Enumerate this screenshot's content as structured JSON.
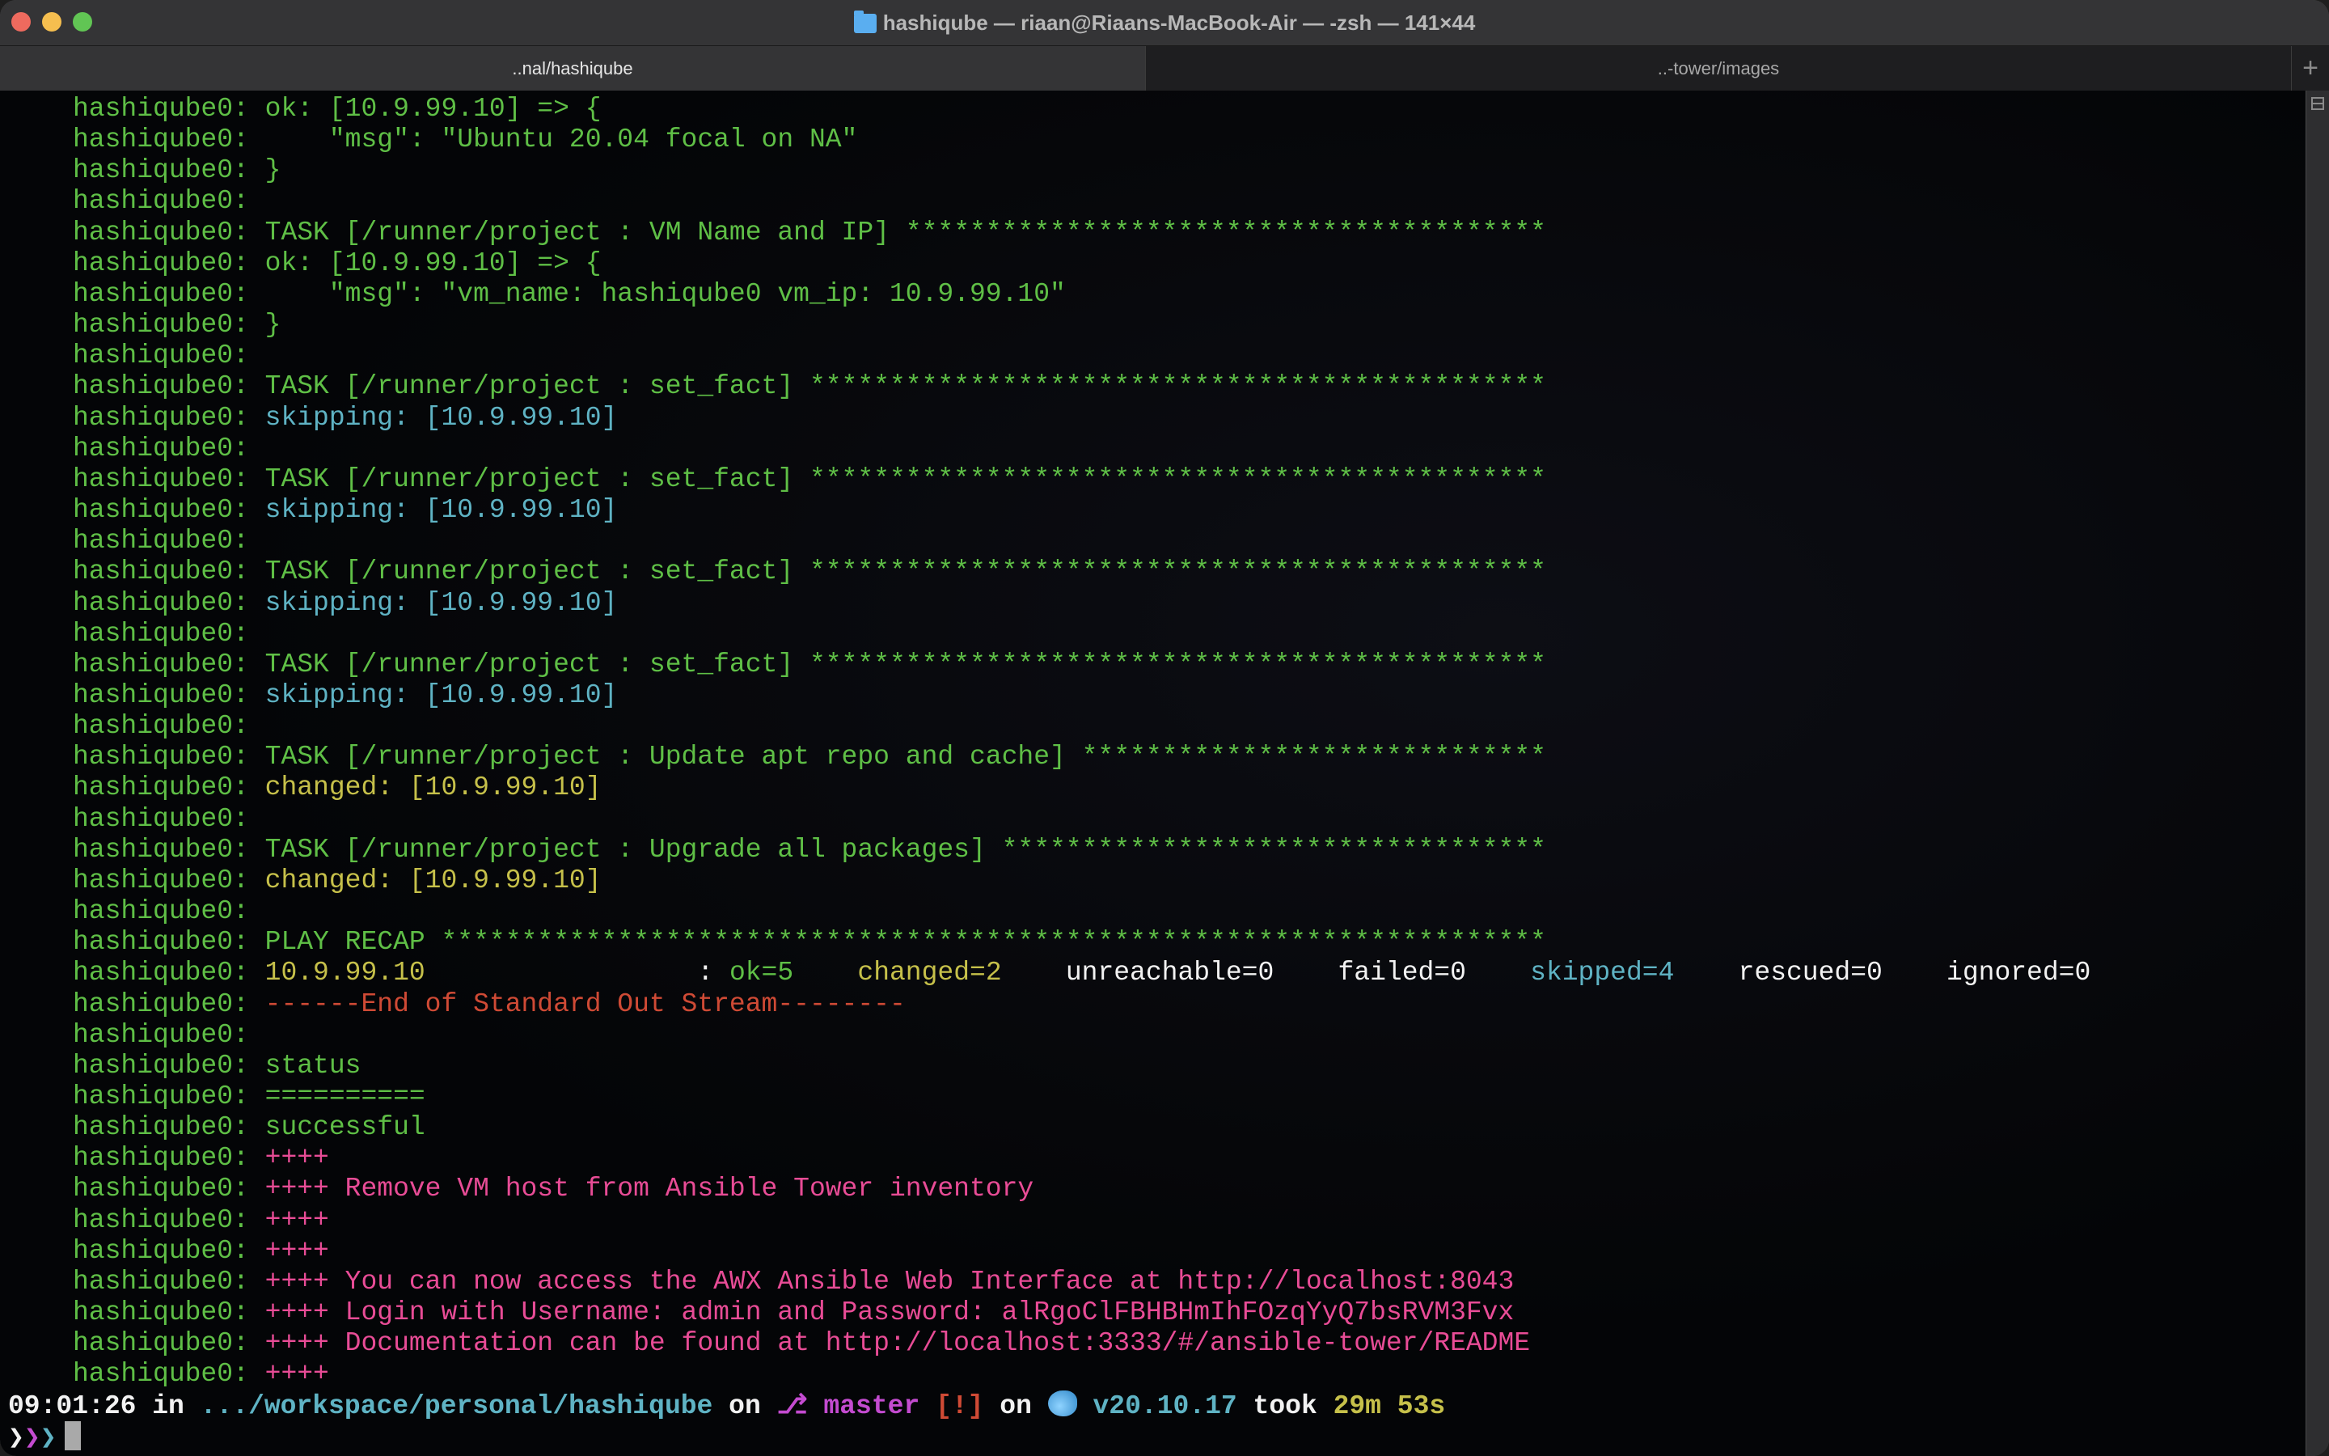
{
  "window": {
    "title": "hashiqube — riaan@Riaans-MacBook-Air — -zsh — 141×44",
    "title_icon": "folder-icon"
  },
  "tabs": [
    {
      "label": "..nal/hashiqube",
      "active": true
    },
    {
      "label": "..-tower/images",
      "active": false
    }
  ],
  "new_tab_label": "+",
  "prefix": "hashiqube0: ",
  "lines": [
    {
      "parts": [
        {
          "t": "ok: [10.9.99.10] => {",
          "c": "g"
        }
      ]
    },
    {
      "parts": [
        {
          "t": "    \"msg\": \"Ubuntu 20.04 focal on NA\"",
          "c": "g"
        }
      ]
    },
    {
      "parts": [
        {
          "t": "}",
          "c": "g"
        }
      ]
    },
    {
      "parts": []
    },
    {
      "parts": [
        {
          "t": "TASK [/runner/project : VM Name and IP] ",
          "c": "g"
        },
        {
          "t": "*****************************************************",
          "c": "g",
          "stars": true
        }
      ]
    },
    {
      "parts": [
        {
          "t": "ok: [10.9.99.10] => {",
          "c": "g"
        }
      ]
    },
    {
      "parts": [
        {
          "t": "    \"msg\": \"vm_name: hashiqube0 vm_ip: 10.9.99.10\"",
          "c": "g"
        }
      ]
    },
    {
      "parts": [
        {
          "t": "}",
          "c": "g"
        }
      ]
    },
    {
      "parts": []
    },
    {
      "parts": [
        {
          "t": "TASK [/runner/project : set_fact] ",
          "c": "g"
        },
        {
          "t": "****************************************",
          "c": "g",
          "stars": true
        }
      ]
    },
    {
      "parts": [
        {
          "t": "skipping: [10.9.99.10]",
          "c": "c"
        }
      ]
    },
    {
      "parts": []
    },
    {
      "parts": [
        {
          "t": "TASK [/runner/project : set_fact] ",
          "c": "g"
        },
        {
          "t": "****************************************",
          "c": "g",
          "stars": true
        }
      ]
    },
    {
      "parts": [
        {
          "t": "skipping: [10.9.99.10]",
          "c": "c"
        }
      ]
    },
    {
      "parts": []
    },
    {
      "parts": [
        {
          "t": "TASK [/runner/project : set_fact] ",
          "c": "g"
        },
        {
          "t": "****************************************",
          "c": "g",
          "stars": true
        }
      ]
    },
    {
      "parts": [
        {
          "t": "skipping: [10.9.99.10]",
          "c": "c"
        }
      ]
    },
    {
      "parts": []
    },
    {
      "parts": [
        {
          "t": "TASK [/runner/project : set_fact] ",
          "c": "g"
        },
        {
          "t": "****************************************",
          "c": "g",
          "stars": true
        }
      ]
    },
    {
      "parts": [
        {
          "t": "skipping: [10.9.99.10]",
          "c": "c"
        }
      ]
    },
    {
      "parts": []
    },
    {
      "parts": [
        {
          "t": "TASK [/runner/project : Update apt repo and cache] ",
          "c": "g"
        },
        {
          "t": "****************************************",
          "c": "g",
          "stars": true
        }
      ]
    },
    {
      "parts": [
        {
          "t": "changed: [10.9.99.10]",
          "c": "y"
        }
      ]
    },
    {
      "parts": []
    },
    {
      "parts": [
        {
          "t": "TASK [/runner/project : Upgrade all packages] ",
          "c": "g"
        },
        {
          "t": "****************************************",
          "c": "g",
          "stars": true
        }
      ]
    },
    {
      "parts": [
        {
          "t": "changed: [10.9.99.10]",
          "c": "y"
        }
      ]
    },
    {
      "parts": []
    },
    {
      "parts": [
        {
          "t": "PLAY RECAP ",
          "c": "g"
        },
        {
          "t": "****************************************",
          "c": "g",
          "stars": true
        }
      ]
    },
    {
      "parts": [
        {
          "t": "10.9.99.10",
          "c": "y"
        },
        {
          "t": "                 : ",
          "c": "w"
        },
        {
          "t": "ok=5",
          "c": "g"
        },
        {
          "t": "    ",
          "c": "w"
        },
        {
          "t": "changed=2",
          "c": "y"
        },
        {
          "t": "    unreachable=0    failed=0    ",
          "c": "w"
        },
        {
          "t": "skipped=4",
          "c": "c"
        },
        {
          "t": "    rescued=0    ignored=0",
          "c": "w"
        }
      ]
    },
    {
      "parts": [
        {
          "t": "------End of Standard Out Stream--------",
          "c": "r"
        }
      ]
    },
    {
      "parts": []
    },
    {
      "parts": [
        {
          "t": "status",
          "c": "g"
        }
      ]
    },
    {
      "parts": [
        {
          "t": "==========",
          "c": "g"
        }
      ]
    },
    {
      "parts": [
        {
          "t": "successful",
          "c": "g"
        }
      ]
    },
    {
      "parts": [
        {
          "t": "++++",
          "c": "p"
        }
      ]
    },
    {
      "parts": [
        {
          "t": "++++ Remove VM host from Ansible Tower inventory",
          "c": "p"
        }
      ]
    },
    {
      "parts": [
        {
          "t": "++++",
          "c": "p"
        }
      ]
    },
    {
      "parts": [
        {
          "t": "++++",
          "c": "p"
        }
      ]
    },
    {
      "parts": [
        {
          "t": "++++ You can now access the AWX Ansible Web Interface at http://localhost:8043",
          "c": "p"
        }
      ]
    },
    {
      "parts": [
        {
          "t": "++++ Login with Username: admin and Password: alRgoClFBHBHmIhFOzqYyQ7bsRVM3Fvx",
          "c": "p"
        }
      ]
    },
    {
      "parts": [
        {
          "t": "++++ Documentation can be found at http://localhost:3333/#/ansible-tower/README",
          "c": "p"
        }
      ]
    },
    {
      "parts": [
        {
          "t": "++++",
          "c": "p"
        }
      ]
    }
  ],
  "line_width_chars": 92,
  "prompt": {
    "time": "09:01:26",
    "in_label": " in ",
    "path": ".../workspace/personal/hashiqube",
    "on_label": " on ",
    "branch_icon": "git-branch-icon",
    "branch": "master",
    "git_status": "[!]",
    "on_label2": " on ",
    "docker_icon": "docker-whale-icon",
    "docker_version": "v20.10.17",
    "took_label": " took ",
    "duration": "29m 53s",
    "symbol": "❯❯❯"
  },
  "colors": {
    "green": "#5fbf46",
    "cyan": "#5fb3c4",
    "yellow": "#c6c04a",
    "white": "#f2f2f2",
    "red": "#cf4a35",
    "pink": "#e84c96",
    "magenta": "#c44bd0"
  }
}
